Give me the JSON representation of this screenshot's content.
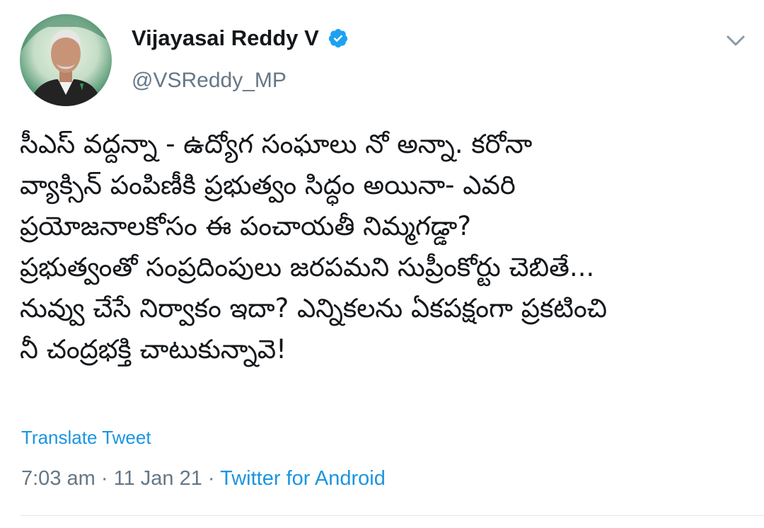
{
  "author": {
    "display_name": "Vijayasai Reddy V",
    "handle": "@VSReddy_MP",
    "verified": true,
    "avatar_icon": "profile-photo",
    "verified_icon": "verified-badge-icon",
    "menu_icon": "chevron-down-icon"
  },
  "tweet": {
    "lines": [
      "సీఎస్ వద్దన్నా -  ఉద్యోగ సంఘాలు నో అన్నా. కరోనా",
      "వ్యాక్సిన్ పంపిణీకి ప్రభుత్వం సిద్ధం అయినా- ఎవరి",
      "ప్రయోజనాలకోసం ఈ పంచాయతీ  నిమ్మగడ్డా?",
      "ప్రభుత్వంతో సంప్రదింపులు జరపమని సుప్రీంకోర్టు చెబితే...",
      "నువ్వు చేసే నిర్వాకం ఇదా? ఎన్నికలను ఏకపక్షంగా ప్రకటించి",
      "నీ  చంద్రభక్తి చాటుకున్నావె!"
    ],
    "translate_label": "Translate Tweet",
    "time": "7:03 am",
    "separator": "·",
    "date": "11 Jan 21",
    "source": "Twitter for Android"
  },
  "colors": {
    "link": "#1b95e0",
    "secondary_text": "#657786",
    "primary_text": "#14171a",
    "verified": "#1da1f2"
  }
}
